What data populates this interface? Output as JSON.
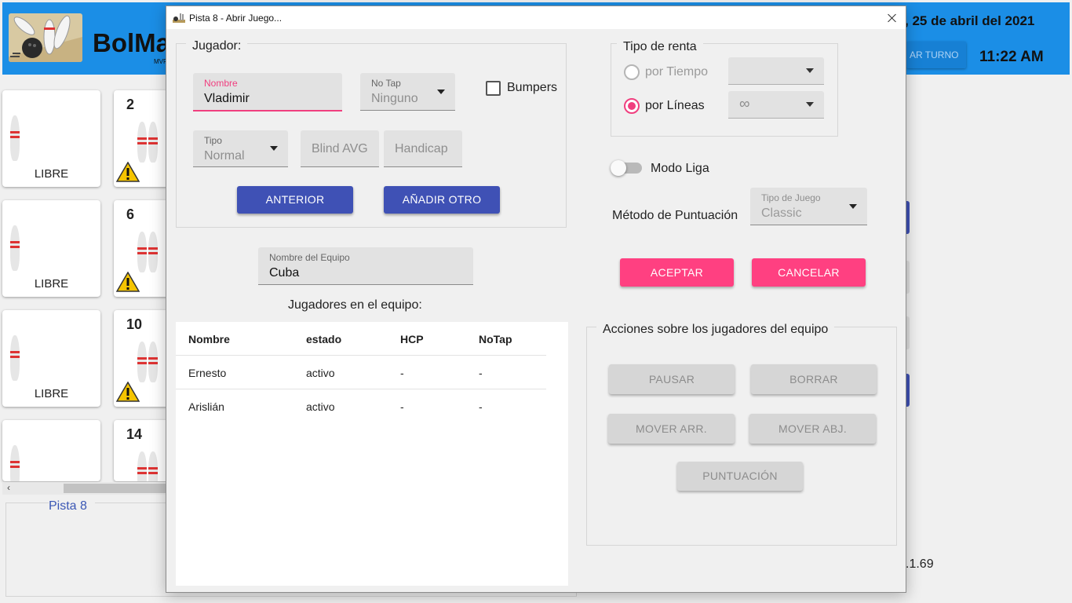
{
  "header": {
    "title": "BolMa",
    "subtitle": "MVP",
    "date": ", 25 de abril del 2021",
    "turno_button": "AR TURNO",
    "time": "11:22 AM"
  },
  "lanes": [
    {
      "number": "",
      "status": "LIBRE"
    },
    {
      "number": "2",
      "status": ""
    },
    {
      "number": "",
      "status": "LIBRE"
    },
    {
      "number": "6",
      "status": ""
    },
    {
      "number": "",
      "status": "LIBRE"
    },
    {
      "number": "10",
      "status": ""
    },
    {
      "number": "",
      "status": ""
    },
    {
      "number": "14",
      "status": ""
    }
  ],
  "bottom_panel": {
    "title": "Pista 8"
  },
  "version": ".1.69",
  "dialog": {
    "title": "Pista 8 - Abrir Juego...",
    "jugador": {
      "legend": "Jugador:",
      "nombre_label": "Nombre",
      "nombre_value": "Vladimir",
      "notap_label": "No Tap",
      "notap_value": "Ninguno",
      "bumpers_label": "Bumpers",
      "bumpers_checked": false,
      "tipo_label": "Tipo",
      "tipo_value": "Normal",
      "blind_avg_placeholder": "Blind AVG",
      "handicap_placeholder": "Handicap",
      "anterior_button": "ANTERIOR",
      "anadir_button": "AÑADIR OTRO"
    },
    "equipo": {
      "nombre_label": "Nombre del Equipo",
      "nombre_value": "Cuba",
      "jugadores_title": "Jugadores en el equipo:",
      "columns": [
        "Nombre",
        "estado",
        "HCP",
        "NoTap"
      ],
      "rows": [
        [
          "Ernesto",
          "activo",
          "-",
          "-"
        ],
        [
          "Arislián",
          "activo",
          "-",
          "-"
        ]
      ]
    },
    "renta": {
      "legend": "Tipo de renta",
      "tiempo_label": "por Tiempo",
      "tiempo_selected": false,
      "tiempo_value": "",
      "lineas_label": "por Líneas",
      "lineas_selected": true,
      "lineas_value": "∞"
    },
    "modo_liga": {
      "label": "Modo Liga",
      "on": false
    },
    "puntuacion": {
      "label": "Método de Puntuación",
      "tipo_label": "Tipo de Juego",
      "tipo_value": "Classic"
    },
    "aceptar_button": "ACEPTAR",
    "cancelar_button": "CANCELAR",
    "acciones": {
      "legend": "Acciones sobre los jugadores del equipo",
      "pausar": "PAUSAR",
      "borrar": "BORRAR",
      "mover_arr": "MOVER ARR.",
      "mover_abj": "MOVER ABJ.",
      "puntuacion": "PUNTUACIÓN"
    }
  },
  "colors": {
    "header_blue": "#1b8ee6",
    "indigo": "#3f51b5",
    "pink": "#ff4081"
  }
}
